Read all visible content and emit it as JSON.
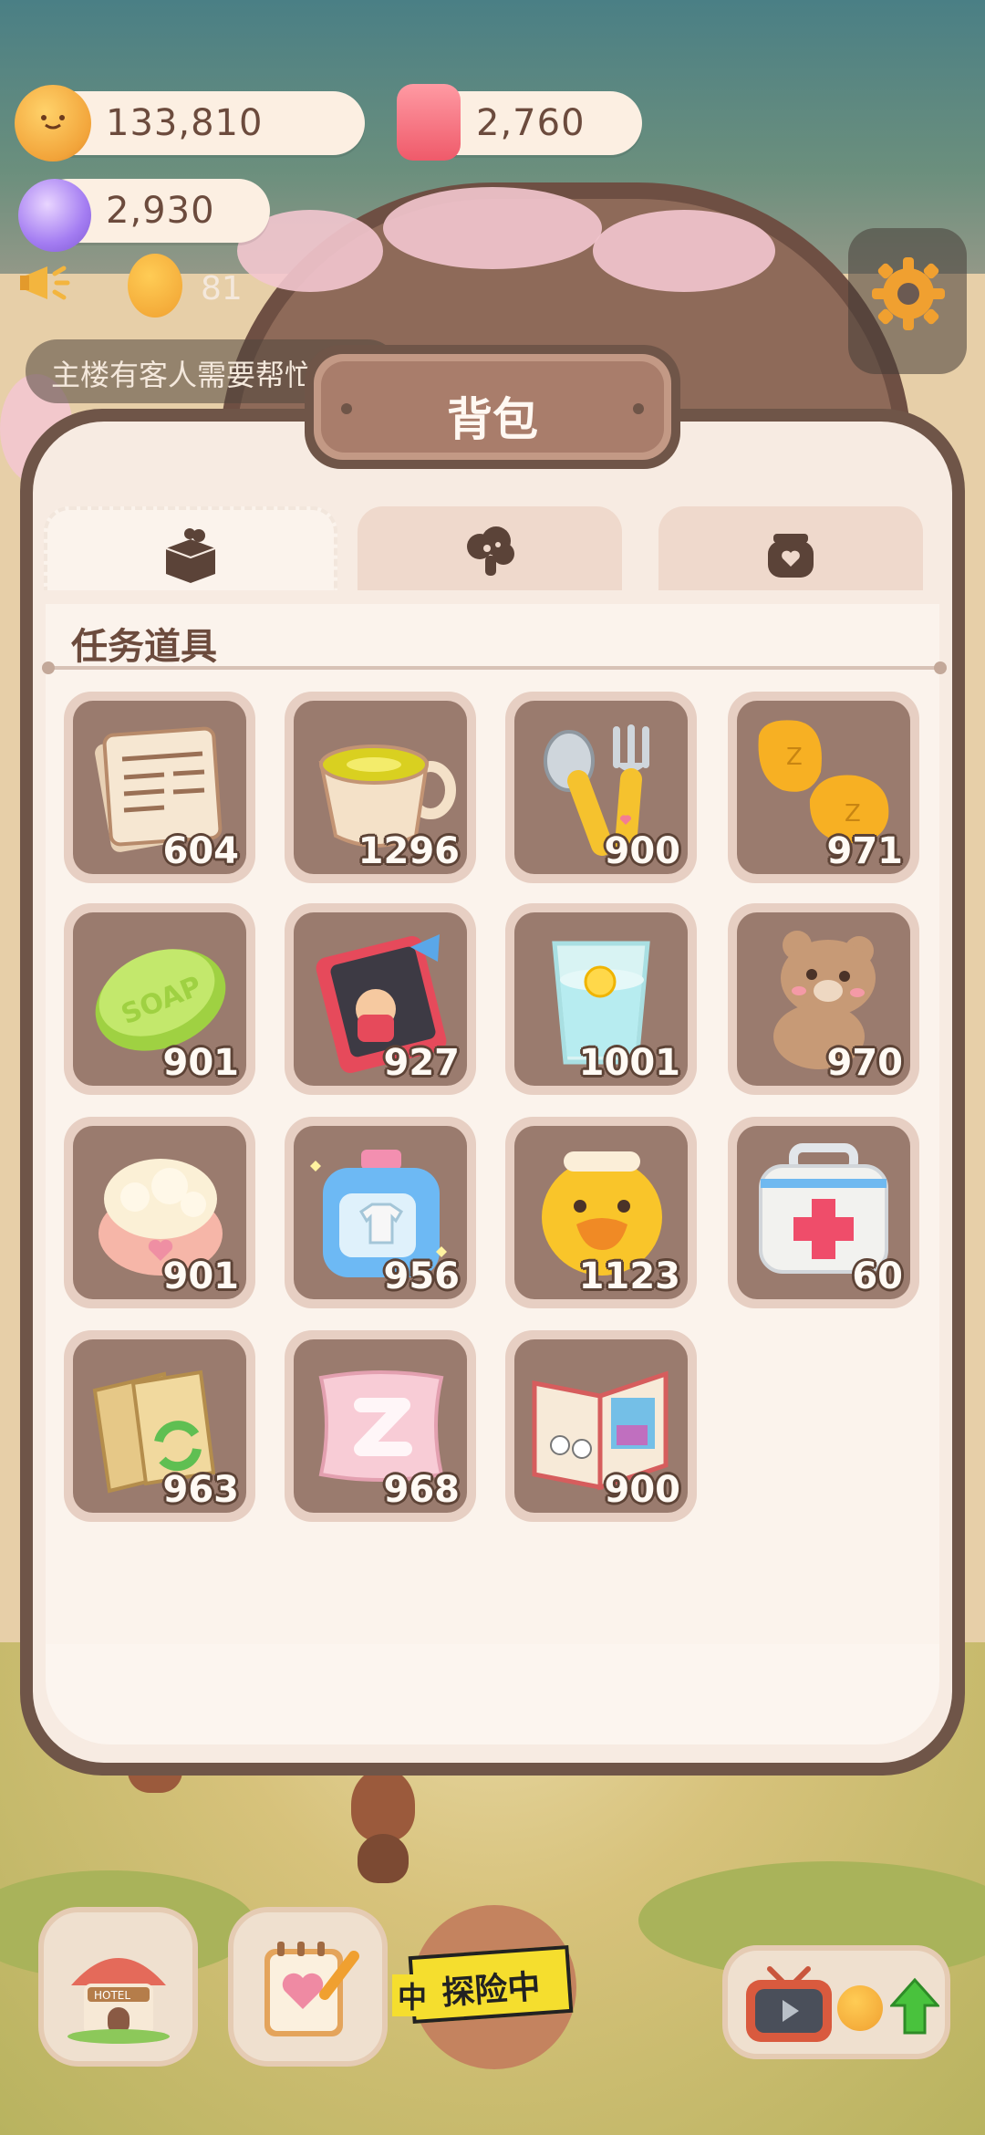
{
  "currencies": {
    "coins": "133,810",
    "candles": "2,760",
    "gems": "2,930"
  },
  "notice": {
    "count": "81",
    "text": "主楼有客人需要帮忙"
  },
  "backpack": {
    "title": "背包",
    "tabs": [
      {
        "name": "task-items-tab",
        "icon": "box-icon",
        "active": true
      },
      {
        "name": "ingredients-tab",
        "icon": "mushroom-icon",
        "active": false
      },
      {
        "name": "potions-tab",
        "icon": "jar-heart-icon",
        "active": false
      }
    ],
    "section_title": "任务道具",
    "items": [
      {
        "name": "newspaper",
        "icon": "newspaper-icon",
        "count": "604"
      },
      {
        "name": "tea-cup",
        "icon": "tea-cup-icon",
        "count": "1296"
      },
      {
        "name": "spoon-fork",
        "icon": "spoon-fork-icon",
        "count": "900"
      },
      {
        "name": "sleep-slippers",
        "icon": "slippers-icon",
        "count": "971"
      },
      {
        "name": "soap",
        "icon": "soap-icon",
        "count": "901"
      },
      {
        "name": "storybook",
        "icon": "storybook-icon",
        "count": "927"
      },
      {
        "name": "lemon-water",
        "icon": "lemon-water-icon",
        "count": "1001"
      },
      {
        "name": "teddy-bear",
        "icon": "teddy-bear-icon",
        "count": "970"
      },
      {
        "name": "bath-puff",
        "icon": "bath-puff-icon",
        "count": "901"
      },
      {
        "name": "detergent",
        "icon": "detergent-icon",
        "count": "956"
      },
      {
        "name": "duck-cushion",
        "icon": "duck-icon",
        "count": "1123"
      },
      {
        "name": "first-aid-kit",
        "icon": "first-aid-icon",
        "count": "60"
      },
      {
        "name": "recycle-bags",
        "icon": "recycle-bag-icon",
        "count": "963"
      },
      {
        "name": "pillow",
        "icon": "pillow-icon",
        "count": "968"
      },
      {
        "name": "magazine",
        "icon": "magazine-icon",
        "count": "900"
      }
    ]
  },
  "bottom_bar": {
    "hotel_label": "HOTEL",
    "explore_label": "探险中",
    "explore_label_partial": "中",
    "soap_label": "SOAP"
  },
  "colors": {
    "panel_border": "#6f5548",
    "panel_bg": "#f7ebe2",
    "slot_bg": "#9a7b6e",
    "text_brown": "#6c4b3d"
  }
}
